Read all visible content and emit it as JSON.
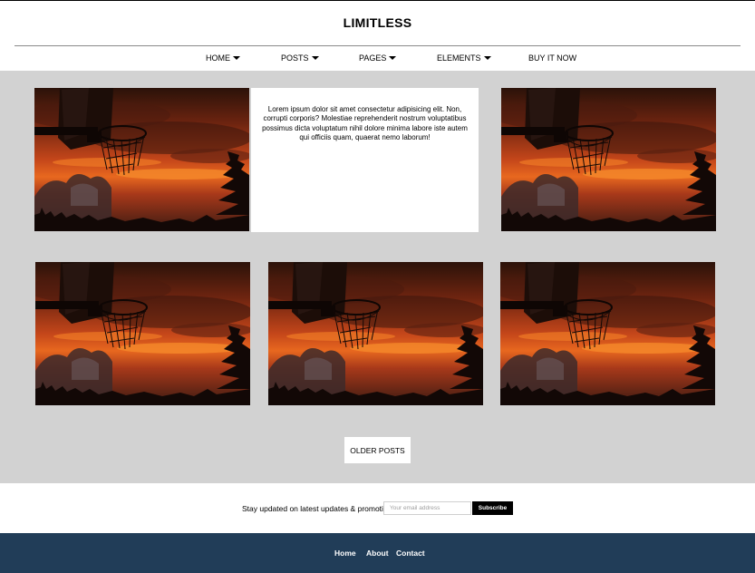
{
  "header": {
    "title": "LIMITLESS"
  },
  "nav": {
    "items": [
      {
        "label": "HOME",
        "dropdown": true
      },
      {
        "label": "POSTS",
        "dropdown": true
      },
      {
        "label": "PAGES",
        "dropdown": true
      },
      {
        "label": "ELEMENTS",
        "dropdown": true
      },
      {
        "label": "BUY IT NOW",
        "dropdown": false
      }
    ]
  },
  "main": {
    "featured_text": "Lorem ipsum dolor sit amet consectetur adipisicing elit. Non, corrupti corporis? Molestiae reprehenderit nostrum voluptatibus possimus dicta voluptatum nihil dolore minima labore iste autem qui officiis quam, quaerat nemo laborum!",
    "post_image_icon": "basketball-hoop-sunset-image",
    "older_posts_label": "OLDER POSTS"
  },
  "newsletter": {
    "label": "Stay updated on latest updates & promotions",
    "email_placeholder": "Your email address",
    "subscribe_label": "Subscribe"
  },
  "footer": {
    "links": [
      "Home",
      "About",
      "Contact"
    ]
  },
  "colors": {
    "content_bg": "#d2d2d2",
    "footer_bg": "#213d58",
    "button_dark": "#000000"
  }
}
